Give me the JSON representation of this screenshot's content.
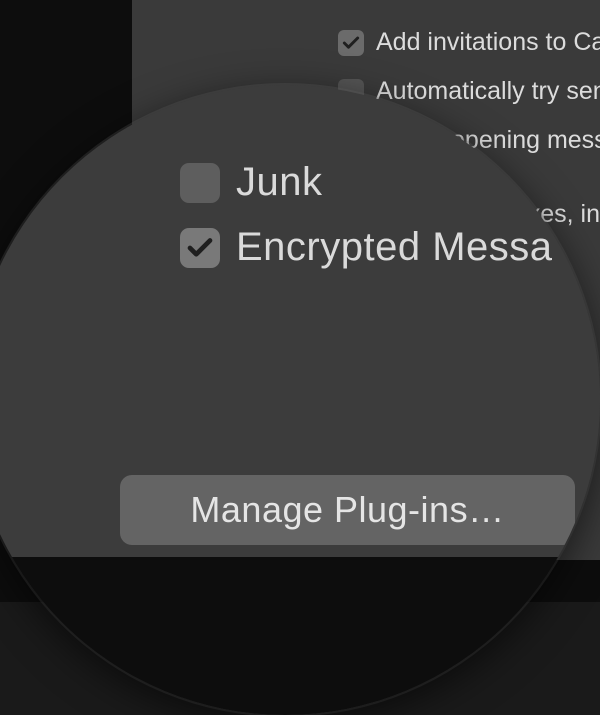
{
  "prefs": {
    "rows": [
      {
        "label": "Add invitations to Calendar au",
        "checked": true
      },
      {
        "label": "Automatically try sending late",
        "checked": false
      },
      {
        "label": "Prefer opening messages in s",
        "checked": true
      }
    ],
    "side_fragment": "xes, in"
  },
  "magnifier": {
    "truncated_top_fragment": "",
    "rows": [
      {
        "label": "Junk",
        "checked": false
      },
      {
        "label": "Encrypted Messa",
        "checked": true
      }
    ],
    "button_label": "Manage Plug-ins…"
  }
}
